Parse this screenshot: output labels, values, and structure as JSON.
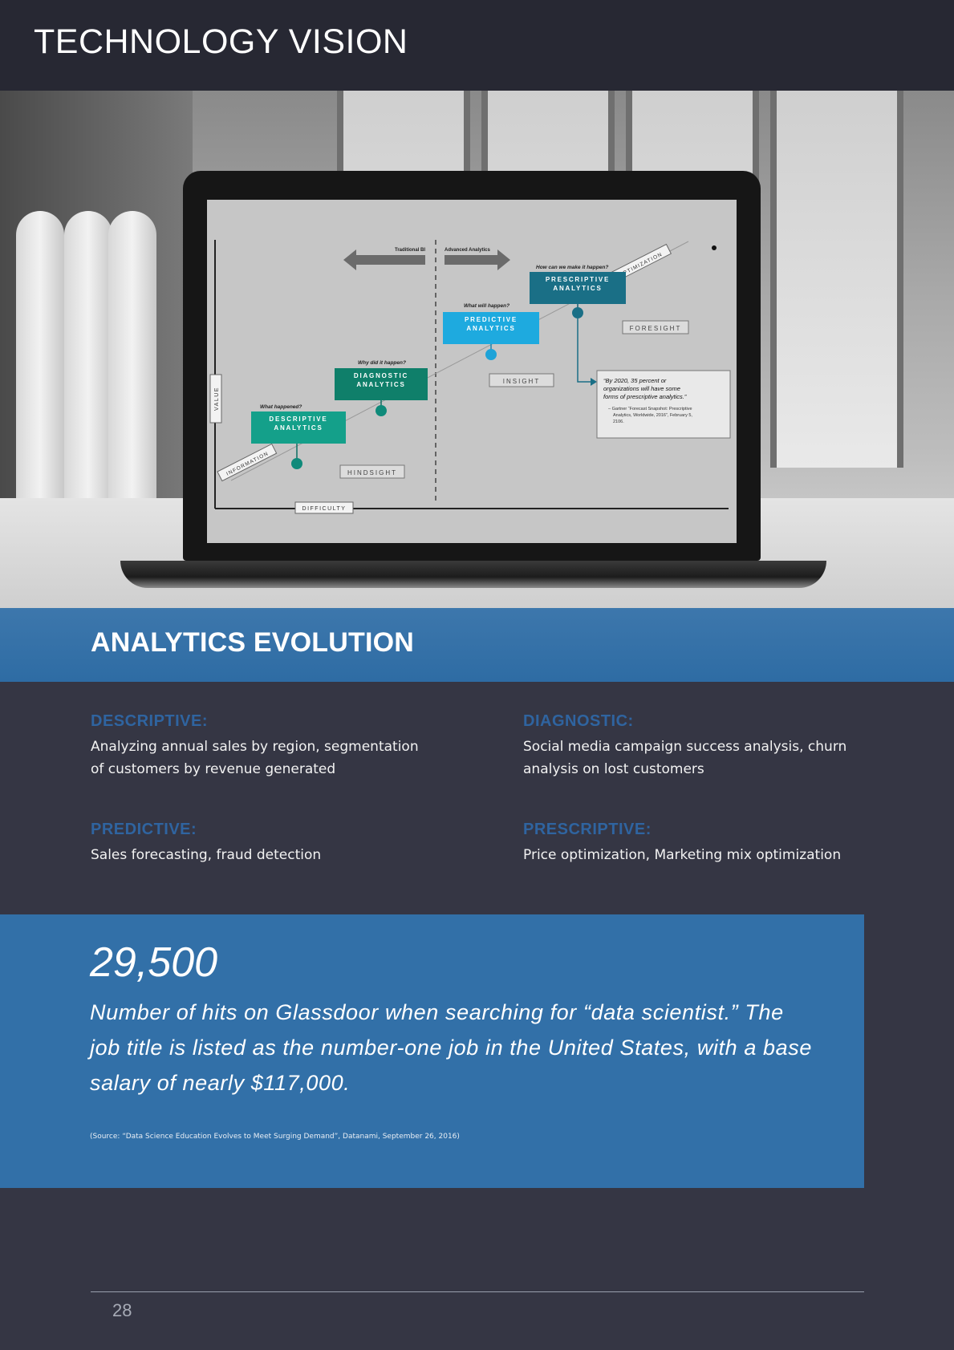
{
  "header": {
    "title": "TECHNOLOGY VISION"
  },
  "screen_diagram": {
    "traditional_label": "Traditional BI",
    "advanced_label": "Advanced Analytics",
    "axis_value": "VALUE",
    "axis_difficulty": "DIFFICULTY",
    "diag_information": "INFORMATION",
    "diag_optimization": "OPTIMIZATION",
    "hindsight": "HINDSIGHT",
    "insight": "INSIGHT",
    "foresight": "FORESIGHT",
    "descriptive_q": "What happened?",
    "descriptive_l1": "DESCRIPTIVE",
    "descriptive_l2": "ANALYTICS",
    "diagnostic_q": "Why did it happen?",
    "diagnostic_l1": "DIAGNOSTIC",
    "diagnostic_l2": "ANALYTICS",
    "predictive_q": "What will happen?",
    "predictive_l1": "PREDICTIVE",
    "predictive_l2": "ANALYTICS",
    "prescriptive_q": "How can we make it happen?",
    "prescriptive_l1": "PRESCRIPTIVE",
    "prescriptive_l2": "ANALYTICS",
    "quote_l1": "“By 2020, 35 percent or",
    "quote_l2": "organizations will have some",
    "quote_l3": "forms of prescriptive analytics.”",
    "cite_l1": "– Gartner “Forecast Snapshot: Prescriptive",
    "cite_l2": "Analytics, Worldwide, 2016”, February 5,",
    "cite_l3": "2106."
  },
  "band": {
    "title": "ANALYTICS EVOLUTION"
  },
  "items": {
    "descriptive": {
      "title": "DESCRIPTIVE:",
      "text": "Analyzing annual sales by region, segmentation of customers by revenue generated"
    },
    "diagnostic": {
      "title": "DIAGNOSTIC:",
      "text": "Social media campaign success analysis, churn analysis on lost customers"
    },
    "predictive": {
      "title": "PREDICTIVE:",
      "text": "Sales forecasting, fraud detection"
    },
    "prescriptive": {
      "title": "PRESCRIPTIVE:",
      "text": "Price optimization, Marketing mix optimization"
    }
  },
  "stat": {
    "number": "29,500",
    "text": "Number of hits on Glassdoor when searching for “data scientist.” The job title is listed as the number-one job in the United States, with a base salary of nearly $117,000.",
    "source": "(Source: “Data Science Education Evolves to Meet Surging Demand”, Datanami, September 26, 2016)"
  },
  "footer": {
    "page_number": "28"
  },
  "colors": {
    "page_bg": "#353644",
    "header_bg": "#272833",
    "accent_blue": "#3270a8",
    "heading_blue": "#2f64a0",
    "teal": "#0f8a7a",
    "cyan": "#1ea3d8",
    "dark_teal": "#1a6f86"
  }
}
